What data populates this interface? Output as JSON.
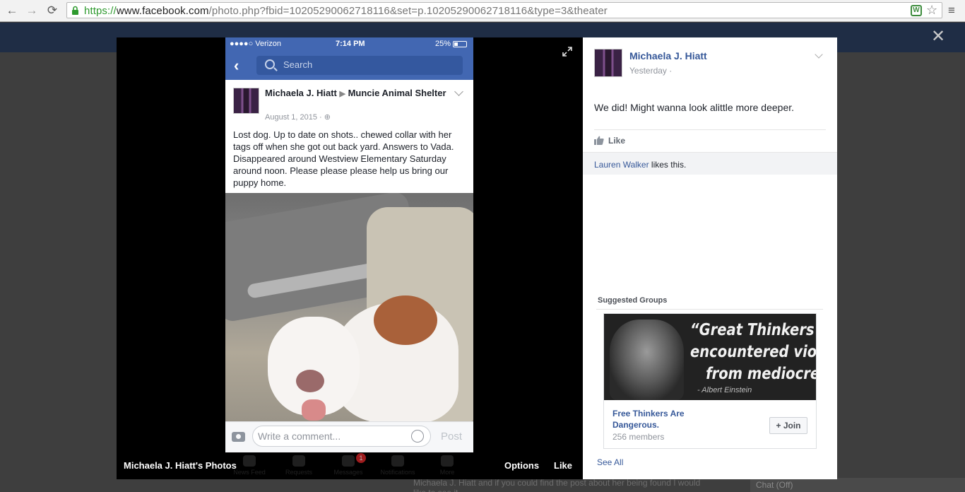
{
  "browser": {
    "url_scheme": "https://",
    "url_host": "www.facebook.com",
    "url_path": "/photo.php?fbid=10205290062718116&set=p.10205290062718116&type=3&theater",
    "back_glyph": "←",
    "forward_glyph": "→",
    "reload_glyph": "⟳",
    "ext_glyph": "W",
    "star_glyph": "☆",
    "menu_glyph": "≡"
  },
  "theater": {
    "close_glyph": "✕",
    "caption": "Michaela J. Hiatt's Photos",
    "options_label": "Options",
    "like_label": "Like"
  },
  "phone": {
    "carrier": "●●●●○ Verizon",
    "time": "7:14 PM",
    "battery": "25%",
    "back_glyph": "‹",
    "search_placeholder": "Search",
    "post": {
      "author": "Michaela J. Hiatt",
      "arrow": "▶",
      "target": "Muncie Animal Shelter",
      "date": "August 1, 2015 · ⊕",
      "text": "Lost dog. Up to date on shots.. chewed collar with her tags off when she got out back yard. Answers to Vada. Disappeared around Westview Elementary Saturday around noon. Please please please help us bring our puppy home."
    },
    "comment_placeholder": "Write a comment...",
    "post_label": "Post",
    "ghost_tabs": [
      "News Feed",
      "Requests",
      "Messages",
      "Notifications",
      "More"
    ],
    "messages_badge": "1"
  },
  "sidebar": {
    "author": "Michaela J. Hiatt",
    "time": "Yesterday ·",
    "message": "We did! Might wanna look alittle more deeper.",
    "like_label": "Like",
    "likes_name": "Lauren Walker",
    "likes_suffix": " likes this.",
    "suggested_title": "Suggested Groups",
    "group": {
      "quote_line1": "“Great Thinkers ha",
      "quote_line2": "encountered violen",
      "quote_line3": "from mediocre",
      "quote_author": "- Albert Einstein",
      "name": "Free Thinkers Are Dangerous.",
      "members": "256 members",
      "join_label": "+ Join"
    },
    "see_all": "See All"
  },
  "background": {
    "strip_text": "Michaela J. Hiatt and if you could find the post about her being found I would like to see it.",
    "chat_label": "Chat (Off)"
  }
}
